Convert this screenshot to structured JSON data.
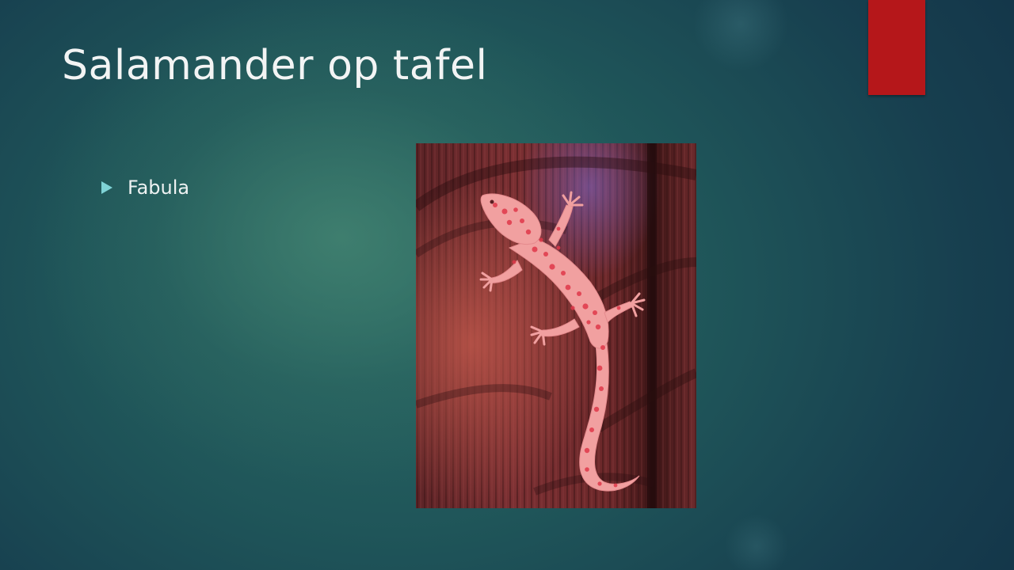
{
  "slide": {
    "title": "Salamander op tafel",
    "bullets": [
      {
        "text": "Fabula",
        "icon": "triangle-bullet-icon"
      }
    ],
    "colors": {
      "background_dark": "#14374a",
      "background_mid": "#2a6863",
      "accent_tab": "#b5171a",
      "bullet_marker": "#7fd3d6",
      "text": "#f2f4f4"
    },
    "image": {
      "subject": "red spotted gecko on wooden table",
      "palette": [
        "#6e2a2c",
        "#8a3336",
        "#e35a62",
        "#f39c9e"
      ]
    }
  }
}
